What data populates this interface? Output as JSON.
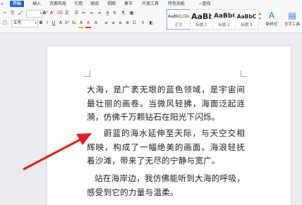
{
  "ribbon": {
    "tabs": [
      "开始",
      "插入",
      "页面布局",
      "引用",
      "审阅",
      "视图",
      "章节",
      "开发工具",
      "特色功能"
    ],
    "active_tab": "开始",
    "search_label": "查找",
    "font_name": "",
    "font_size": "五号",
    "styles": [
      {
        "sample": "AaBbCcDd",
        "label": "正文"
      },
      {
        "sample": "AaBb",
        "label": "标题 1"
      },
      {
        "sample": "AaBbC",
        "label": "标题 2"
      },
      {
        "sample": "AaBbC",
        "label": "标题 3"
      }
    ],
    "new_style_label": "新样式",
    "text_tool_label": "文字工具"
  },
  "document": {
    "paragraphs": [
      "大海，是广袤无垠的蓝色领域，是宇宙间最壮丽的画卷。当微风轻拂，海面泛起涟漪，仿佛千万颗钻石在阳光下闪烁。",
      "蔚蓝的海水延伸至天际，与天空交相辉映，构成了一幅绝美的画面。海浪轻抚着沙滩，带来了无尽的宁静与宽广。",
      "站在海岸边，我仿佛能听到大海的呼吸，感受到它的力量与温柔。"
    ]
  },
  "colors": {
    "accent": "#1e64d3",
    "arrow": "#e02020"
  }
}
